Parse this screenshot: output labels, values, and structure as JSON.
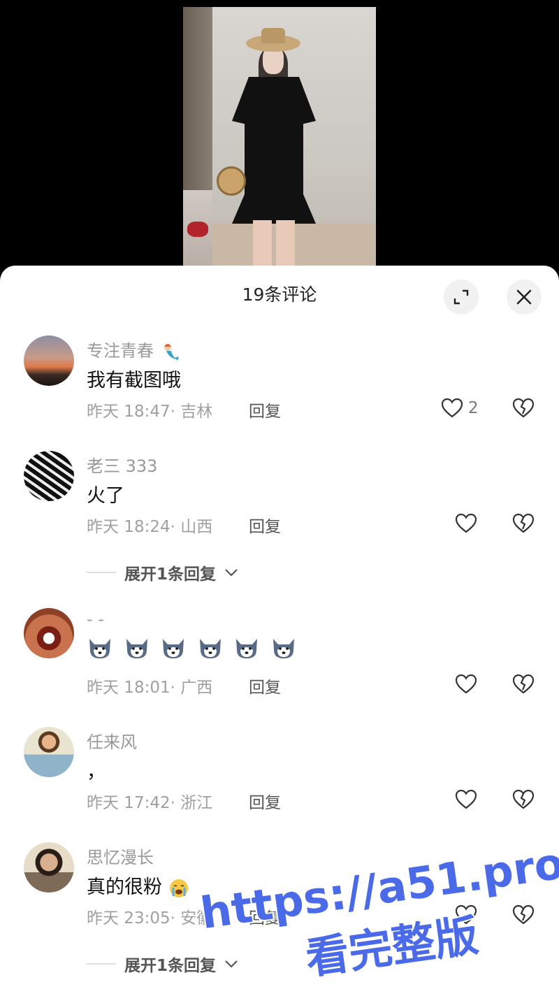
{
  "sheet": {
    "title": "19条评论"
  },
  "colors": {
    "sheet_bg": "#ffffff",
    "username": "#999999",
    "meta": "#a0a0a0",
    "watermark": "#3b5bdb"
  },
  "comments": [
    {
      "username": "专注青春",
      "username_badge": "mermaid-emoji",
      "text": "我有截图哦",
      "time": "昨天 18:47",
      "location": "· 吉林",
      "reply_label": "回复",
      "likes": "2",
      "avatar": "sunset-avatar"
    },
    {
      "username": "老三 333",
      "text": "火了",
      "time": "昨天 18:24",
      "location": "· 山西",
      "reply_label": "回复",
      "expand_label": "展开1条回复",
      "avatar": "zebra-pattern-avatar"
    },
    {
      "username": "-      -",
      "text_emojis": [
        "husky-emoji",
        "husky-emoji",
        "husky-emoji",
        "husky-emoji",
        "husky-emoji",
        "husky-emoji"
      ],
      "time": "昨天 18:01",
      "location": "· 广西",
      "reply_label": "回复",
      "avatar": "laughing-face-avatar"
    },
    {
      "username": "任来风",
      "text": "，",
      "time": "昨天 17:42",
      "location": "· 浙江",
      "reply_label": "回复",
      "avatar": "cartoon-person-avatar"
    },
    {
      "username": "思忆漫长",
      "text": "真的很粉",
      "text_emoji": "crying-emoji",
      "time": "昨天 23:05",
      "location": "· 安徽",
      "reply_label": "回复",
      "expand_label": "展开1条回复",
      "avatar": "man-portrait-avatar"
    }
  ],
  "watermark": {
    "line1": "https://a51.pro",
    "line2": "看完整版"
  }
}
